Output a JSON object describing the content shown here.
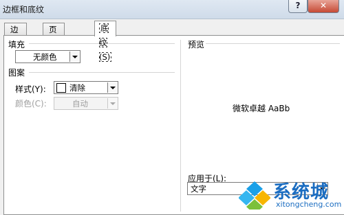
{
  "window": {
    "title": "边框和底纹",
    "help_label": "?",
    "close_label": "✕"
  },
  "tabs": [
    {
      "label": "边框(B)"
    },
    {
      "label": "页面边框(P)"
    },
    {
      "label": "底纹(S)",
      "active": true
    }
  ],
  "fill": {
    "label": "填充",
    "value": "无颜色"
  },
  "pattern": {
    "label": "图案",
    "style_label": "样式(Y):",
    "style_value": "清除",
    "color_label": "颜色(C):",
    "color_value": "自动"
  },
  "preview": {
    "label": "预览",
    "sample_text": "微软卓越  AaBb"
  },
  "apply": {
    "label": "应用于(L):",
    "value": "文字"
  },
  "watermark": {
    "brand": "系统城",
    "site": "xitongcheng.com"
  }
}
